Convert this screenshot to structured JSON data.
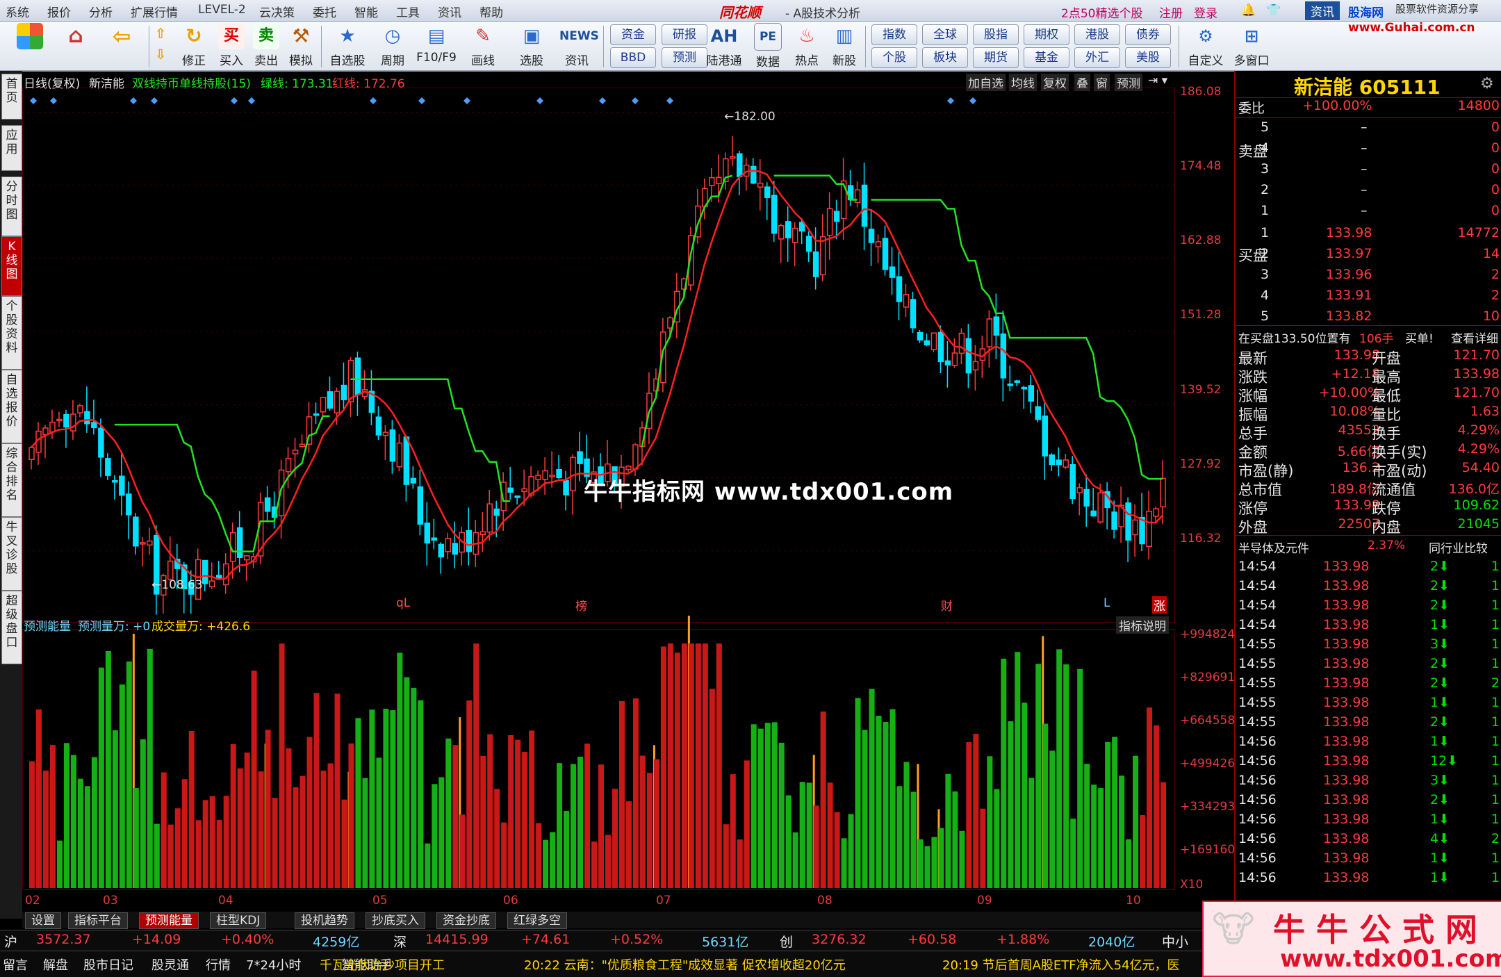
{
  "menu": [
    "系统",
    "报价",
    "分析",
    "扩展行情",
    "LEVEL-2",
    "云决策",
    "委托",
    "智能",
    "工具",
    "资讯",
    "帮助"
  ],
  "app": {
    "logo": "同花顺",
    "subtitle": "- A股技术分析"
  },
  "top_right": {
    "promo": "2点50精选个股",
    "register": "注册",
    "login": "登录",
    "news": "资讯",
    "brand": "股海网",
    "brand_tag": "股票软件资源分享",
    "url": "www.Guhai.com.cn"
  },
  "toolbar": [
    {
      "name": "home",
      "label": ""
    },
    {
      "name": "home-icon",
      "label": ""
    },
    {
      "name": "back",
      "label": ""
    },
    {
      "name": "fix",
      "label": "修正"
    },
    {
      "name": "buy",
      "label": "买入"
    },
    {
      "name": "sell",
      "label": "卖出"
    },
    {
      "name": "sim",
      "label": "模拟"
    },
    {
      "name": "watchlist",
      "label": "自选股"
    },
    {
      "name": "period",
      "label": "周期"
    },
    {
      "name": "f10",
      "label": "F10/F9"
    },
    {
      "name": "draw",
      "label": "画线"
    },
    {
      "name": "pick",
      "label": "选股"
    },
    {
      "name": "news",
      "label": "资讯"
    }
  ],
  "toolbar_text": {
    "buy_glyph": "买",
    "sell_glyph": "卖",
    "news_glyph": "NEWS",
    "ah_glyph": "AH",
    "pe_glyph": "PE",
    "pills_a": [
      "资金",
      "BBD"
    ],
    "pills_b": [
      "研报",
      "预测"
    ],
    "ah": "陆港通",
    "pe": "数据",
    "hot": "热点",
    "new": "新股",
    "pills_c": [
      "指数",
      "个股"
    ],
    "pills_d": [
      "全球",
      "板块"
    ],
    "pills_e": [
      "股指",
      "期货"
    ],
    "pills_f": [
      "期权",
      "基金"
    ],
    "pills_g": [
      "港股",
      "外汇"
    ],
    "pills_h": [
      "债券",
      "美股"
    ],
    "custom": "自定义",
    "multi": "多窗口"
  },
  "left_tabs": [
    "首页",
    "应用",
    "分时图",
    "K线图",
    "个股资料",
    "自选报价",
    "综合排名",
    "牛叉诊股",
    "超级盘口"
  ],
  "chart_header": {
    "period": "日线(复权)",
    "stock": "新洁能",
    "indicator": "双线持币单线持股(15)",
    "green_label": "绿线: 173.31",
    "red_label": "红线: 172.76"
  },
  "chart_buttons": [
    "加自选",
    "均线",
    "复权",
    "叠",
    "窗",
    "预测"
  ],
  "price_axis": [
    "186.08",
    "174.48",
    "162.88",
    "151.28",
    "139.52",
    "127.92",
    "116.32"
  ],
  "annotations": {
    "high": "182.00",
    "low": "108.63"
  },
  "event_marks": [
    "qL",
    "榜",
    "财",
    "L",
    "涨"
  ],
  "volume_header": {
    "name": "预测能量",
    "pred": "预测量万: +0",
    "vol": "成交量万: +426.6"
  },
  "volume_button": "指标说明",
  "volume_axis": [
    "+994824",
    "+829691",
    "+664558",
    "+499426",
    "+334293",
    "+169160"
  ],
  "volume_unit": "X10",
  "date_axis": [
    "02",
    "03",
    "04",
    "05",
    "06",
    "07",
    "08",
    "09",
    "10"
  ],
  "watermark": "牛牛指标网 www.tdx001.com",
  "quote": {
    "title": "新洁能 605111",
    "weibi_label": "委比",
    "weibi": "+100.00%",
    "weicha": "14800",
    "sell_label": "卖盘",
    "buy_label": "买盘",
    "asks": [
      {
        "lvl": "5",
        "p": "–",
        "v": "0"
      },
      {
        "lvl": "4",
        "p": "–",
        "v": "0"
      },
      {
        "lvl": "3",
        "p": "–",
        "v": "0"
      },
      {
        "lvl": "2",
        "p": "–",
        "v": "0"
      },
      {
        "lvl": "1",
        "p": "–",
        "v": "0"
      }
    ],
    "bids": [
      {
        "lvl": "1",
        "p": "133.98",
        "v": "14772"
      },
      {
        "lvl": "2",
        "p": "133.97",
        "v": "14"
      },
      {
        "lvl": "3",
        "p": "133.96",
        "v": "2"
      },
      {
        "lvl": "4",
        "p": "133.91",
        "v": "2"
      },
      {
        "lvl": "5",
        "p": "133.82",
        "v": "10"
      }
    ],
    "notice": "在买盘133.50位置有",
    "notice_qty": "106手",
    "notice_tag": "买单!",
    "notice_link": "查看详细",
    "stats": [
      [
        "最新",
        "133.98",
        "开盘",
        "121.70"
      ],
      [
        "涨跌",
        "+12.18",
        "最高",
        "133.98"
      ],
      [
        "涨幅",
        "+10.00%",
        "最低",
        "121.70"
      ],
      [
        "振幅",
        "10.08%",
        "量比",
        "1.63"
      ],
      [
        "总手",
        "43552",
        "换手",
        "4.29%"
      ],
      [
        "金额",
        "5.66亿",
        "换手(实)",
        "4.29%"
      ],
      [
        "市盈(静)",
        "136.2",
        "市盈(动)",
        "54.40"
      ],
      [
        "总市值",
        "189.8亿",
        "流通值",
        "136.0亿"
      ],
      [
        "涨停",
        "133.98",
        "跌停",
        "109.62"
      ],
      [
        "外盘",
        "22507",
        "内盘",
        "21045"
      ]
    ],
    "industry": "半导体及元件",
    "industry_pct": "2.37%",
    "industry_btn": "同行业比较",
    "ticks": [
      [
        "14:54",
        "133.98",
        "2",
        "1"
      ],
      [
        "14:54",
        "133.98",
        "2",
        "1"
      ],
      [
        "14:54",
        "133.98",
        "2",
        "1"
      ],
      [
        "14:54",
        "133.98",
        "1",
        "1"
      ],
      [
        "14:55",
        "133.98",
        "3",
        "1"
      ],
      [
        "14:55",
        "133.98",
        "2",
        "1"
      ],
      [
        "14:55",
        "133.98",
        "2",
        "2"
      ],
      [
        "14:55",
        "133.98",
        "1",
        "1"
      ],
      [
        "14:55",
        "133.98",
        "2",
        "1"
      ],
      [
        "14:56",
        "133.98",
        "1",
        "1"
      ],
      [
        "14:56",
        "133.98",
        "12",
        "1"
      ],
      [
        "14:56",
        "133.98",
        "3",
        "1"
      ],
      [
        "14:56",
        "133.98",
        "2",
        "1"
      ],
      [
        "14:56",
        "133.98",
        "1",
        "1"
      ],
      [
        "14:56",
        "133.98",
        "4",
        "2"
      ],
      [
        "14:56",
        "133.98",
        "1",
        "1"
      ],
      [
        "14:56",
        "133.98",
        "1",
        "1"
      ]
    ]
  },
  "indicator_tabs": [
    "设置",
    "指标平台",
    "预测能量",
    "柱型KDJ",
    "投机趋势",
    "抄底买入",
    "资金抄底",
    "红绿多空"
  ],
  "index_bar": [
    {
      "name": "沪",
      "val": "3572.37",
      "chg": "+14.09",
      "pct": "+0.40%",
      "amt": "4259亿"
    },
    {
      "name": "深",
      "val": "14415.99",
      "chg": "+74.61",
      "pct": "+0.52%",
      "amt": "5631亿"
    },
    {
      "name": "创",
      "val": "3276.32",
      "chg": "+60.58",
      "pct": "+1.88%",
      "amt": "2040亿"
    }
  ],
  "index_tail": "中小",
  "news_bar": {
    "buttons": [
      "留言",
      "解盘",
      "股市日记",
      "股灵通",
      "行情",
      "7*24小时",
      "智能助手"
    ],
    "items": [
      "千瓦光伏治沙项目开工",
      "20:22 云南：\"优质粮食工程\"成效显著 促农增收超20亿元",
      "20:19 节后首周A股ETF净流入54亿元，医"
    ]
  },
  "badge": {
    "title": "牛 牛 公 式 网",
    "url": "www.tdx001.com"
  },
  "colors": {
    "up": "#ff3b3b",
    "down": "#00e0ff",
    "ma_red": "#ff2020",
    "ma_green": "#22e322",
    "vol_red": "#c81818",
    "vol_green": "#16b016",
    "accent": "#c00000"
  }
}
